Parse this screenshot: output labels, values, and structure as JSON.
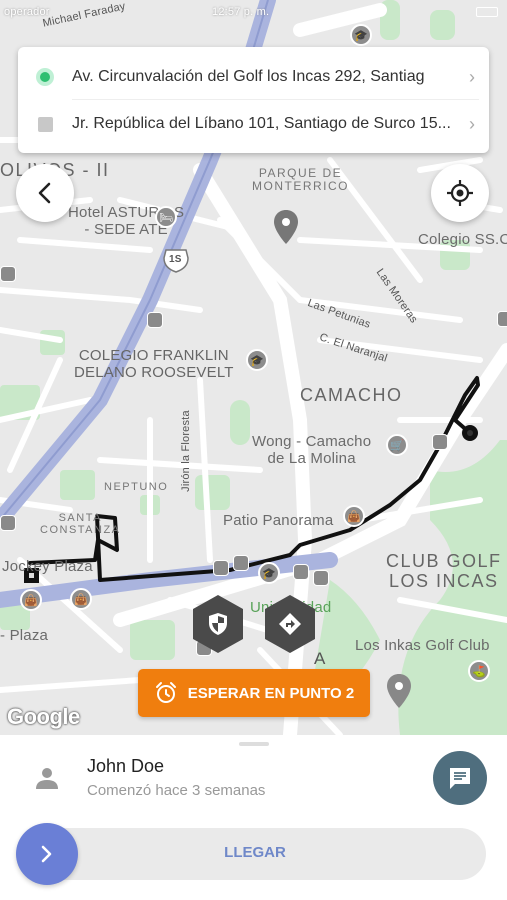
{
  "status_bar": {
    "carrier": "operador",
    "time": "12:57 p. m."
  },
  "address_card": {
    "origin": "Av. Circunvalación del Golf los Incas 292, Santiag",
    "destination": "Jr. República del Líbano 101, Santiago de Surco 15..."
  },
  "map": {
    "labels": {
      "michael_faraday": "Michael Faraday",
      "olivos_ii": "OLIVOS - II",
      "hotel_asturias": "Hotel ASTURIAS\n- SEDE ATE",
      "parque_monterrico": "PARQUE DE\nMONTERRICO",
      "colegio_ss": "Colegio SS.C",
      "las_moreras": "Las Moreras",
      "las_petunias": "Las Petunias",
      "el_naranjal": "C. El Naranjal",
      "colegio_franklin": "COLEGIO FRANKLIN\nDELANO ROOSEVELT",
      "camacho": "CAMACHO",
      "jiron_floresta": "Jirón la Floresta",
      "wong_camacho": "Wong - Camacho\nde La Molina",
      "neptuno": "NEPTUNO",
      "santa_constanza": "SANTA\nCONSTANZA",
      "jockey_plaza": "Jockey Plaza",
      "patio_panorama": "Patio Panorama",
      "club_golf": "CLUB GOLF\nLOS INCAS",
      "universidad": "Universidad",
      "plaza": "- Plaza",
      "los_inkas_golf": "Los Inkas Golf Club",
      "route_1s": "1S",
      "a_label": "A"
    },
    "google": "Google"
  },
  "wait_button": {
    "label": "ESPERAR EN PUNTO 2",
    "icon": "alarm-clock-icon"
  },
  "sheet": {
    "passenger_name": "John Doe",
    "passenger_since": "Comenzó hace 3 semanas",
    "arrive_label": "LLEGAR"
  },
  "colors": {
    "accent_orange": "#f07e0e",
    "slider_blue": "#6a7fd6",
    "chat_button": "#4f6e7e",
    "origin_green": "#2fbf71",
    "route_line": "#111111"
  }
}
